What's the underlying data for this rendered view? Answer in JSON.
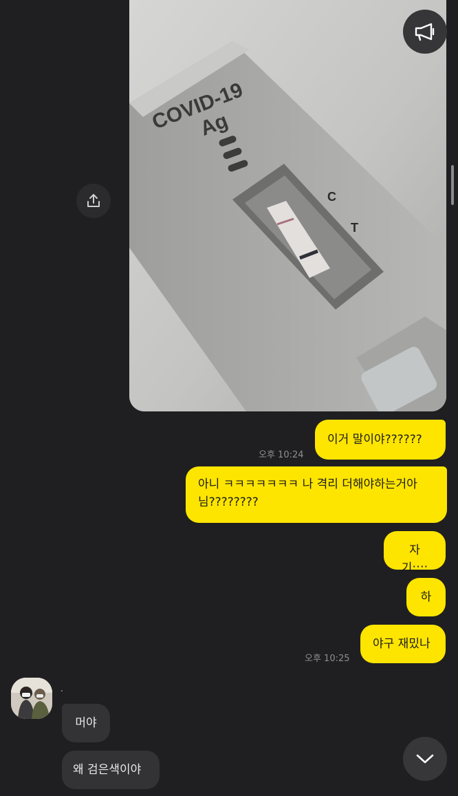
{
  "photo": {
    "test_title_line1": "COVID-19",
    "test_title_line2": "Ag",
    "marker_c": "C",
    "marker_t": "T"
  },
  "icons": {
    "speaker": "megaphone-icon",
    "share": "share-upload-icon",
    "scroll_down": "chevron-down-icon"
  },
  "colors": {
    "background": "#1f1f21",
    "my_bubble": "#fee500",
    "their_bubble": "#333336"
  },
  "messages": [
    {
      "from": "me",
      "text": "이거 말이야??????"
    },
    {
      "from": "me",
      "text": "아니 ㅋㅋㅋㅋㅋㅋㅋ 나 격리 더해야하는거아님????????"
    },
    {
      "from": "me",
      "text": "자기;;;;"
    },
    {
      "from": "me",
      "text": "하"
    },
    {
      "from": "me",
      "text": "야구 재밌나"
    },
    {
      "from": "them",
      "text": "머야"
    },
    {
      "from": "them",
      "text": "왜 검은색이야"
    }
  ],
  "timestamps": {
    "t1": "오후 10:24",
    "t2": "오후 10:25"
  },
  "sender": {
    "name": "."
  }
}
